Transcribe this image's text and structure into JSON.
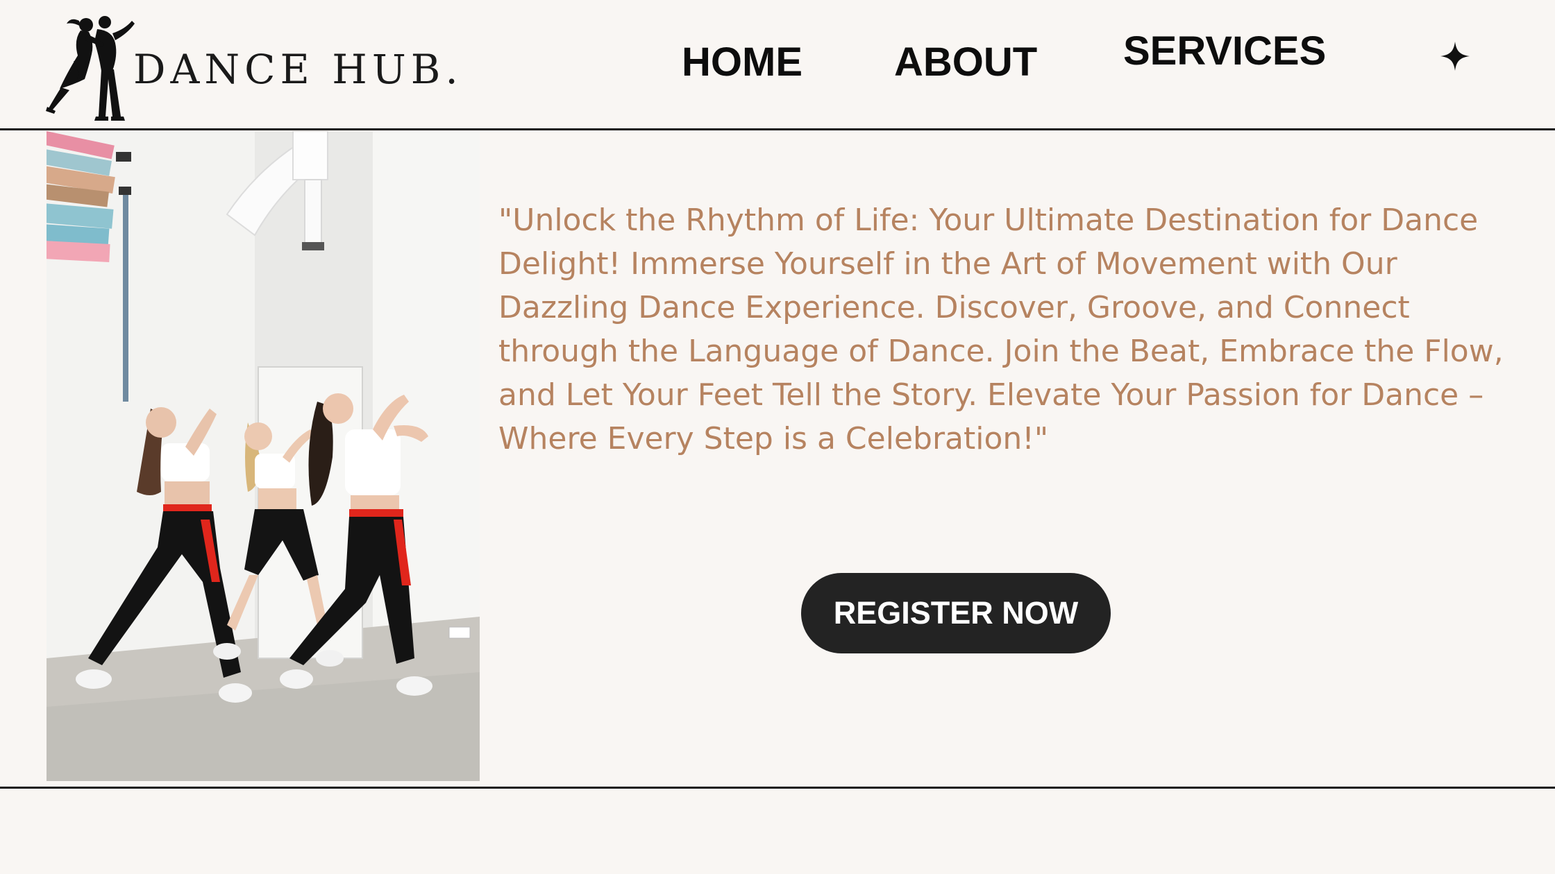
{
  "brand": {
    "name": "DANCE HUB.",
    "logo_icon": "dancing-couple-silhouette"
  },
  "nav": {
    "items": [
      {
        "label": "HOME"
      },
      {
        "label": "ABOUT"
      },
      {
        "label": "SERVICES"
      }
    ],
    "extra_icon": "four-point-star-icon"
  },
  "hero": {
    "image": "three-dancers-studio-photo",
    "tagline": "\"Unlock the Rhythm of Life: Your Ultimate Destination for Dance Delight! Immerse Yourself in the Art of Movement with Our Dazzling Dance Experience. Discover, Groove, and Connect through the Language of Dance. Join the Beat, Embrace the Flow, and Let Your Feet Tell the Story. Elevate Your Passion for Dance – Where Every Step is a Celebration!\"",
    "cta_label": "REGISTER NOW"
  },
  "colors": {
    "background": "#f9f6f3",
    "tagline_text": "#b68360",
    "button_bg": "#232323",
    "button_text": "#ffffff",
    "nav_text": "#0d0d0d"
  }
}
